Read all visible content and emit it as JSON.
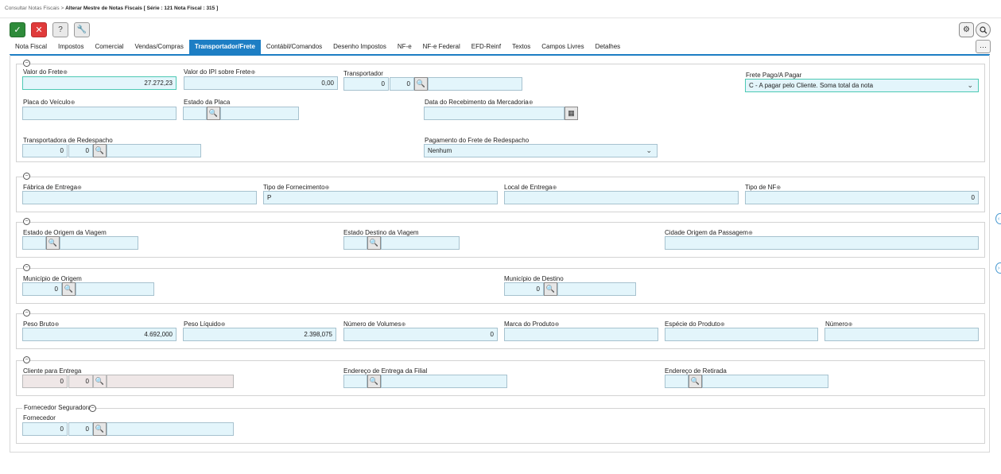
{
  "breadcrumb": {
    "parent": "Consultar Notas Fiscais",
    "separator": ">",
    "current": "Alterar Mestre de Notas Fiscais [ Série : 121 Nota Fiscal : 315 ]"
  },
  "toolbar": {
    "confirm_icon": "check-icon",
    "cancel_icon": "close-icon",
    "help_label": "?",
    "tool_icon": "wrench-icon",
    "settings_icon": "gear-icon",
    "search_icon": "search-icon",
    "more_label": "···"
  },
  "tabs": [
    {
      "label": "Nota Fiscal"
    },
    {
      "label": "Impostos"
    },
    {
      "label": "Comercial"
    },
    {
      "label": "Vendas/Compras"
    },
    {
      "label": "Transportador/Frete",
      "active": true
    },
    {
      "label": "Contábil/Comandos"
    },
    {
      "label": "Desenho Impostos"
    },
    {
      "label": "NF-e"
    },
    {
      "label": "NF-e Federal"
    },
    {
      "label": "EFD-Reinf"
    },
    {
      "label": "Textos"
    },
    {
      "label": "Campos Livres"
    },
    {
      "label": "Detalhes"
    }
  ],
  "colors": {
    "accent": "#1d7ec4",
    "field_bg": "#e3f5fb",
    "highlight": "#4dc9b4",
    "ok": "#2e8b3a",
    "cancel": "#e03a3a"
  },
  "frete": {
    "valor_frete_label": "Valor do Frete",
    "valor_frete": "27.272,23",
    "valor_ipi_label": "Valor do IPI sobre Frete",
    "valor_ipi": "0,00",
    "transportador_label": "Transportador",
    "transportador_a": "0",
    "transportador_b": "0",
    "frete_pago_label": "Frete Pago/A Pagar",
    "frete_pago_value": "C - A pagar pelo Cliente. Soma total da nota",
    "placa_label": "Placa do Veículo",
    "estado_placa_label": "Estado da Placa",
    "data_receb_label": "Data do Recebimento da Mercadoria",
    "redespacho_label": "Transportadora de Redespacho",
    "redespacho_a": "0",
    "redespacho_b": "0",
    "pagamento_redespacho_label": "Pagamento do Frete de Redespacho",
    "pagamento_redespacho_value": "Nenhum"
  },
  "entrega": {
    "fabrica_label": "Fábrica de Entrega",
    "tipo_fornec_label": "Tipo de Fornecimento",
    "tipo_fornec_value": "P",
    "local_label": "Local de Entrega",
    "tipo_nf_label": "Tipo de NF",
    "tipo_nf_value": "0"
  },
  "viagem": {
    "estado_origem_label": "Estado de Origem da Viagem",
    "estado_destino_label": "Estado Destino da Viagem",
    "cidade_passagem_label": "Cidade Origem da Passagem"
  },
  "municipio": {
    "origem_label": "Município de Origem",
    "origem_value": "0",
    "destino_label": "Município de Destino",
    "destino_value": "0"
  },
  "volumes": {
    "peso_bruto_label": "Peso Bruto",
    "peso_bruto": "4.692,000",
    "peso_liquido_label": "Peso Líquido",
    "peso_liquido": "2.398,075",
    "num_volumes_label": "Número de Volumes",
    "num_volumes": "0",
    "marca_label": "Marca do Produto",
    "especie_label": "Espécie do Produto",
    "numero_label": "Número"
  },
  "cliente": {
    "cliente_label": "Cliente para Entrega",
    "cliente_a": "0",
    "cliente_b": "0",
    "endereco_filial_label": "Endereço de Entrega da Filial",
    "endereco_retirada_label": "Endereço de Retirada"
  },
  "seguradora": {
    "legend": "Fornecedor Seguradora",
    "fornecedor_label": "Fornecedor",
    "fornecedor_a": "0",
    "fornecedor_b": "0"
  }
}
